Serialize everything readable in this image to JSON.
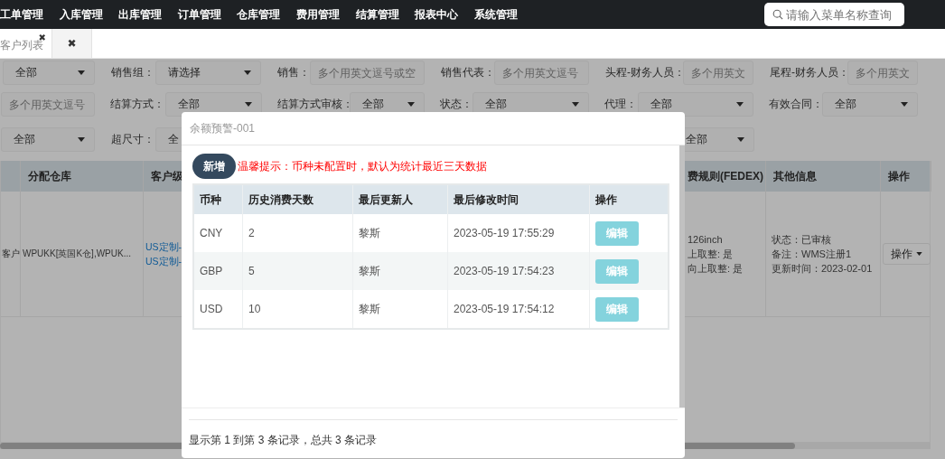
{
  "nav": {
    "items": [
      "工单管理",
      "入库管理",
      "出库管理",
      "订单管理",
      "仓库管理",
      "费用管理",
      "结算管理",
      "报表中心",
      "系统管理"
    ],
    "search": {
      "placeholder": "请输入菜单名称查询"
    }
  },
  "tabs": [
    {
      "label": "客户列表",
      "close": "✖",
      "selected": true
    },
    {
      "close": "✖",
      "selected": false
    }
  ],
  "filters": [
    [
      {
        "kind": "select",
        "value": "全部"
      },
      {
        "kind": "label",
        "text": "销售组："
      },
      {
        "kind": "select",
        "value": "请选择"
      },
      {
        "kind": "label",
        "text": "销售："
      },
      {
        "kind": "input",
        "placeholder": "多个用英文逗号或空"
      },
      {
        "kind": "label",
        "text": "销售代表："
      },
      {
        "kind": "input",
        "placeholder": "多个用英文逗号"
      },
      {
        "kind": "label",
        "text": "头程-财务人员："
      },
      {
        "kind": "input",
        "placeholder": "多个用英文"
      },
      {
        "kind": "label",
        "text": "尾程-财务人员："
      },
      {
        "kind": "input",
        "placeholder": "多个用英文"
      }
    ],
    [
      {
        "kind": "input",
        "placeholder": "多个用英文逗号"
      },
      {
        "kind": "label",
        "text": "结算方式："
      },
      {
        "kind": "select",
        "value": "全部"
      },
      {
        "kind": "label",
        "text": "结算方式审核："
      },
      {
        "kind": "select",
        "value": "全部"
      },
      {
        "kind": "label",
        "text": "状态："
      },
      {
        "kind": "select",
        "value": "全部"
      },
      {
        "kind": "label",
        "text": "代理："
      },
      {
        "kind": "select",
        "value": "全部"
      },
      {
        "kind": "label",
        "text": "有效合同："
      },
      {
        "kind": "select",
        "value": "全部"
      }
    ],
    [
      {
        "kind": "select",
        "value": "全部"
      },
      {
        "kind": "label",
        "text": "超尺寸："
      },
      {
        "kind": "select",
        "value": "全"
      },
      {
        "kind": "select",
        "value": "全部"
      }
    ]
  ],
  "table": {
    "columns": [
      "",
      "分配仓库",
      "客户级",
      "费规则(FEDEX)",
      "其他信息",
      "操作"
    ],
    "rows": [
      {
        "cells": [
          {
            "kind": "text",
            "lines": [
              "客户"
            ]
          },
          {
            "kind": "text",
            "lines": [
              "WPUKK[英国K仓],WPUK..."
            ]
          },
          {
            "kind": "links",
            "lines": [
              "US定制-",
              "US定制-"
            ]
          },
          {
            "kind": "text",
            "lines": [
              "126inch",
              "上取整: 是",
              "向上取整: 是"
            ]
          },
          {
            "kind": "text",
            "lines": [
              "状态：已审核",
              "备注：WMS注册1",
              "更新时间：2023-02-01"
            ]
          },
          {
            "kind": "dropdown",
            "lines": [
              "操作"
            ]
          }
        ]
      }
    ]
  },
  "dialog": {
    "title": "余额预警-001",
    "add_button": "新增",
    "hint": "温馨提示：币种未配置时，默认为统计最近三天数据",
    "columns": [
      "币种",
      "历史消费天数",
      "最后更新人",
      "最后修改时间",
      "操作"
    ],
    "rows": [
      {
        "cells": [
          "CNY",
          "2",
          "黎斯",
          "2023-05-19 17:55:29"
        ],
        "action": "编辑"
      },
      {
        "cells": [
          "GBP",
          "5",
          "黎斯",
          "2023-05-19 17:54:23"
        ],
        "action": "编辑"
      },
      {
        "cells": [
          "USD",
          "10",
          "黎斯",
          "2023-05-19 17:54:12"
        ],
        "action": "编辑"
      }
    ],
    "footer": "显示第 1 到第 3 条记录，总共 3 条记录"
  }
}
